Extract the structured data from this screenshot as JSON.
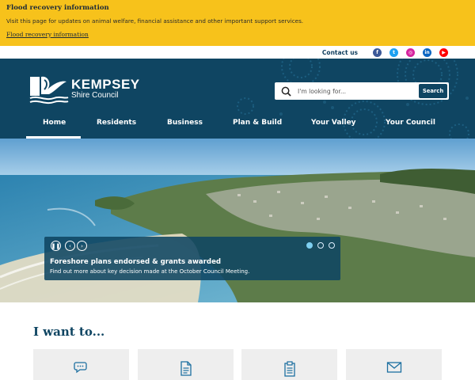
{
  "alert": {
    "title": "Flood recovery information",
    "text": "Visit this page for updates on animal welfare, financial assistance and other important support services.",
    "link": "Flood recovery information",
    "background": "#f7c21b"
  },
  "utility": {
    "contact": "Contact us",
    "social": [
      {
        "name": "facebook-icon",
        "glyph": "f",
        "color": "#3b5998"
      },
      {
        "name": "twitter-icon",
        "glyph": "t",
        "color": "#1da1f2"
      },
      {
        "name": "instagram-icon",
        "glyph": "◎",
        "color": "#d6249f"
      },
      {
        "name": "linkedin-icon",
        "glyph": "in",
        "color": "#0a66c2"
      },
      {
        "name": "youtube-icon",
        "glyph": "▶",
        "color": "#ff0000"
      }
    ]
  },
  "header": {
    "logo_name": "KEMPSEY",
    "logo_sub": "Shire Council",
    "brand_color": "#0f4562",
    "search_placeholder": "I'm looking for...",
    "search_button": "Search"
  },
  "nav": {
    "items": [
      "Home",
      "Residents",
      "Business",
      "Plan & Build",
      "Your Valley",
      "Your Council"
    ],
    "active": "Home"
  },
  "hero": {
    "caption_title": "Foreshore plans endorsed & grants awarded",
    "caption_text": "Find out more about key decision made at the October Council Meeting.",
    "slide_count": 3,
    "active_slide": 1,
    "pause_icon": "pause-icon",
    "prev_icon": "chevron-left-icon",
    "next_icon": "chevron-right-icon"
  },
  "iwant": {
    "title": "I want to...",
    "cards": [
      {
        "icon": "chat-icon"
      },
      {
        "icon": "document-icon"
      },
      {
        "icon": "clipboard-icon"
      },
      {
        "icon": "envelope-icon"
      }
    ]
  }
}
